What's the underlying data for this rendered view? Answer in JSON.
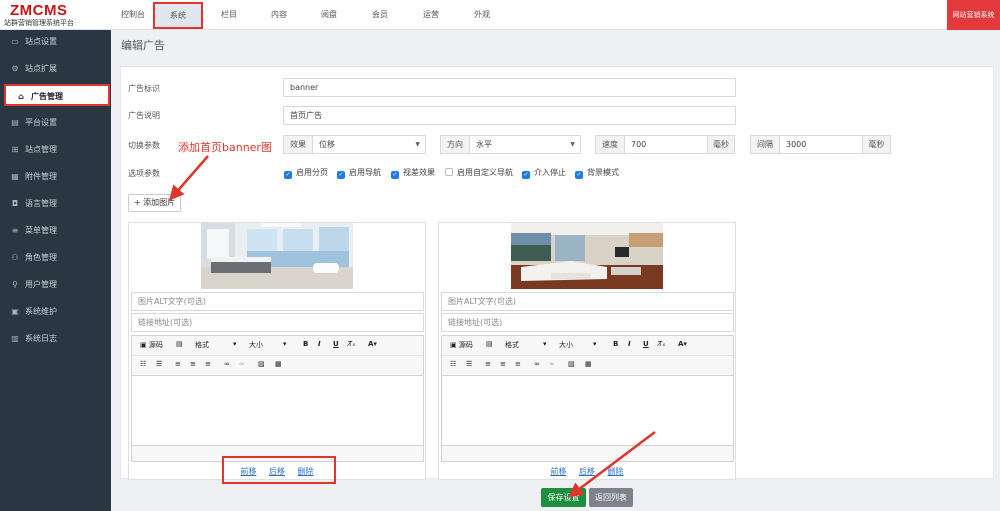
{
  "logo": {
    "brand": "ZMCMS",
    "subtitle": "站群营销管理系统平台"
  },
  "topnav": [
    {
      "label": "控制台"
    },
    {
      "label": "系统"
    },
    {
      "label": "栏目"
    },
    {
      "label": "内容"
    },
    {
      "label": "阅盘"
    },
    {
      "label": "会员"
    },
    {
      "label": "运营"
    },
    {
      "label": "外观"
    }
  ],
  "promo": "网站营销系统",
  "sidebar": [
    {
      "label": "站点设置",
      "icon": "monitor-icon"
    },
    {
      "label": "站点扩展",
      "icon": "gear-icon"
    },
    {
      "label": "广告管理",
      "icon": "ad-icon"
    },
    {
      "label": "平台设置",
      "icon": "platform-icon"
    },
    {
      "label": "站点管理",
      "icon": "sitemap-icon"
    },
    {
      "label": "附件管理",
      "icon": "attachment-icon"
    },
    {
      "label": "语言管理",
      "icon": "language-icon"
    },
    {
      "label": "菜单管理",
      "icon": "menu-icon"
    },
    {
      "label": "角色管理",
      "icon": "roles-icon"
    },
    {
      "label": "用户管理",
      "icon": "user-icon"
    },
    {
      "label": "系统维护",
      "icon": "database-icon"
    },
    {
      "label": "系统日志",
      "icon": "log-icon"
    }
  ],
  "page_title": "编辑广告",
  "form": {
    "id_label": "广告标识",
    "id_value": "banner",
    "desc_label": "广告说明",
    "desc_value": "首页广告",
    "switch_label": "切换参数",
    "effect_addon": "效果",
    "effect_value": "位移",
    "direction_addon": "方向",
    "direction_value": "水平",
    "speed_addon": "速度",
    "speed_value": "700",
    "speed_unit": "毫秒",
    "interval_addon": "间隔",
    "interval_value": "3000",
    "interval_unit": "毫秒",
    "options_label": "选项参数",
    "options": [
      {
        "label": "启用分页",
        "checked": true
      },
      {
        "label": "启用导航",
        "checked": true
      },
      {
        "label": "视差效果",
        "checked": true
      },
      {
        "label": "启用自定义导航",
        "checked": false
      },
      {
        "label": "介入停止",
        "checked": true
      },
      {
        "label": "背景模式",
        "checked": true
      }
    ],
    "add_image": "+ 添加图片"
  },
  "cards": [
    {
      "alt_placeholder": "图片ALT文字(可选)",
      "link_placeholder": "链接地址(可选)",
      "toolbar": {
        "source": "源码",
        "format": "格式",
        "size": "大小"
      },
      "links": [
        "前移",
        "后移",
        "删除"
      ]
    },
    {
      "alt_placeholder": "图片ALT文字(可选)",
      "link_placeholder": "链接地址(可选)",
      "toolbar": {
        "source": "源码",
        "format": "格式",
        "size": "大小"
      },
      "links": [
        "前移",
        "后移",
        "删除"
      ]
    }
  ],
  "buttons": {
    "save": "保存设置",
    "back": "返回列表"
  },
  "annotation": "添加首页banner图",
  "colors": {
    "accent_red": "#e0352b",
    "sidebar_bg": "#2b3643",
    "save_green": "#1e8f3e",
    "link_blue": "#2b6fc9",
    "checkbox_blue": "#1e7be0"
  }
}
